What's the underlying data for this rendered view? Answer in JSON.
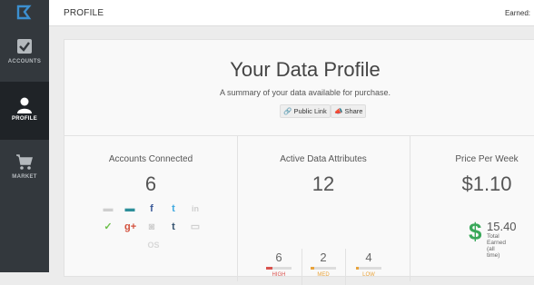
{
  "sidebar": {
    "items": [
      {
        "label": "ACCOUNTS",
        "icon": "checkbox-icon",
        "active": false
      },
      {
        "label": "PROFILE",
        "icon": "user-icon",
        "active": true
      },
      {
        "label": "MARKET",
        "icon": "cart-icon",
        "active": false
      }
    ]
  },
  "header": {
    "title": "PROFILE",
    "earned_label": "Earned:"
  },
  "hero": {
    "title": "Your Data Profile",
    "subtitle": "A summary of your data available for purchase.",
    "public_link_label": "Public Link",
    "share_label": "Share"
  },
  "accounts": {
    "title": "Accounts Connected",
    "count": "6",
    "icons": [
      {
        "name": "credit-card-icon",
        "color": "#cfcfcf"
      },
      {
        "name": "credit-card-icon",
        "color": "#2d8f9a"
      },
      {
        "name": "facebook-icon",
        "color": "#3b5998"
      },
      {
        "name": "twitter-icon",
        "color": "#3fa9e0"
      },
      {
        "name": "linkedin-icon",
        "color": "#cfcfcf"
      },
      {
        "name": "feedly-icon",
        "color": "#6cc04a"
      },
      {
        "name": "google-plus-icon",
        "color": "#d3503c"
      },
      {
        "name": "instagram-icon",
        "color": "#cfcfcf"
      },
      {
        "name": "tumblr-icon",
        "color": "#34526f"
      },
      {
        "name": "keyboard-icon",
        "color": "#cfcfcf"
      },
      {
        "name": "apple-icon",
        "color": "#d8d8d8"
      }
    ],
    "icon_glyphs": [
      "▬",
      "▬",
      "f",
      "t",
      "in",
      "✓",
      "g+",
      "◙",
      "t",
      "▭",
      "OS"
    ]
  },
  "attributes": {
    "title": "Active Data Attributes",
    "count": "12",
    "levels": [
      {
        "count": "6",
        "label": "HIGH",
        "color": "#d9534f",
        "fill": 0.25
      },
      {
        "count": "2",
        "label": "MED",
        "color": "#e8a33c",
        "fill": 0.15
      },
      {
        "count": "4",
        "label": "LOW",
        "color": "#e8a33c",
        "fill": 0.12
      }
    ]
  },
  "price": {
    "title": "Price Per Week",
    "value": "$1.10",
    "dollar_sign": "$",
    "earned_amount": "15.40",
    "earned_label_line1": "Total Earned",
    "earned_label_line2": "(all time)"
  }
}
